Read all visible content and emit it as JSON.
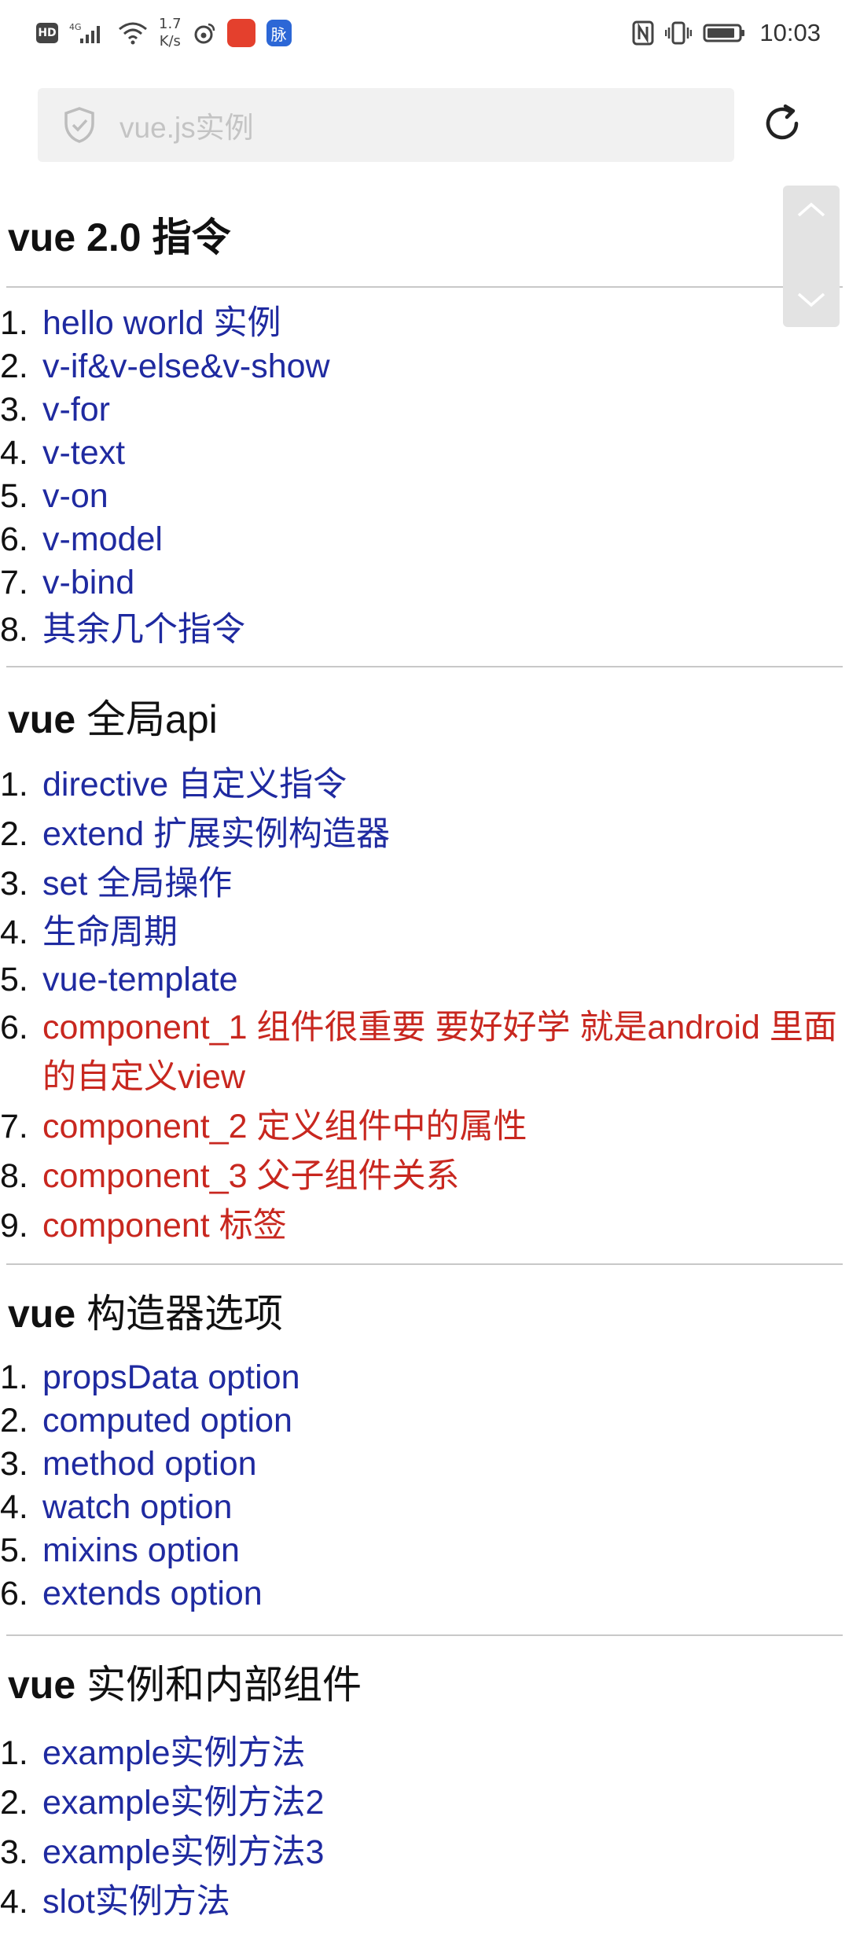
{
  "status_bar": {
    "hd": "HD",
    "network": "4G",
    "net_speed_value": "1.7",
    "net_speed_unit": "K/s",
    "time": "10:03",
    "app_badge_b": "脉",
    "icons": [
      "hd-icon",
      "signal-4g-icon",
      "wifi-icon",
      "net-speed",
      "weibo-icon",
      "app-badge-icon",
      "mai-app-icon",
      "nfc-icon",
      "vibrate-icon",
      "battery-icon"
    ]
  },
  "address_bar": {
    "url": "vue.js实例",
    "icons": [
      "shield-icon",
      "reload-icon"
    ]
  },
  "scroll_control": {
    "icons": [
      "chevron-up-icon",
      "chevron-down-icon"
    ]
  },
  "sections": [
    {
      "heading_bold": "vue 2.0 ",
      "heading_rest": "指令",
      "items": [
        {
          "num": "1.",
          "text": "hello world 实例",
          "color": "#1f2aa0"
        },
        {
          "num": "2.",
          "text": "v-if&v-else&v-show",
          "color": "#1f2aa0"
        },
        {
          "num": "3.",
          "text": "v-for",
          "color": "#1f2aa0"
        },
        {
          "num": "4.",
          "text": "v-text",
          "color": "#1f2aa0"
        },
        {
          "num": "5.",
          "text": "v-on",
          "color": "#1f2aa0"
        },
        {
          "num": "6.",
          "text": "v-model",
          "color": "#1f2aa0"
        },
        {
          "num": "7.",
          "text": "v-bind",
          "color": "#1f2aa0"
        },
        {
          "num": "8.",
          "text": "其余几个指令",
          "color": "#1f2aa0"
        }
      ]
    },
    {
      "heading_bold": "vue ",
      "heading_rest": "全局api",
      "items": [
        {
          "num": "1.",
          "text": "directive 自定义指令",
          "color": "#1f2aa0"
        },
        {
          "num": "2.",
          "text": "extend 扩展实例构造器",
          "color": "#1f2aa0"
        },
        {
          "num": "3.",
          "text": "set 全局操作",
          "color": "#1f2aa0"
        },
        {
          "num": "4.",
          "text": "生命周期",
          "color": "#1f2aa0"
        },
        {
          "num": "5.",
          "text": "vue-template",
          "color": "#1f2aa0"
        },
        {
          "num": "6.",
          "text": "component_1 组件很重要 要好好学 就是android 里面的自定义view",
          "color": "#c8271f"
        },
        {
          "num": "7.",
          "text": "component_2 定义组件中的属性",
          "color": "#c8271f"
        },
        {
          "num": "8.",
          "text": "component_3 父子组件关系",
          "color": "#c8271f"
        },
        {
          "num": "9.",
          "text": "component 标签",
          "color": "#c8271f"
        }
      ]
    },
    {
      "heading_bold": "vue ",
      "heading_rest": "构造器选项",
      "items": [
        {
          "num": "1.",
          "text": "propsData option",
          "color": "#1f2aa0"
        },
        {
          "num": "2.",
          "text": "computed option",
          "color": "#1f2aa0"
        },
        {
          "num": "3.",
          "text": "method option",
          "color": "#1f2aa0"
        },
        {
          "num": "4.",
          "text": "watch option",
          "color": "#1f2aa0"
        },
        {
          "num": "5.",
          "text": "mixins option",
          "color": "#1f2aa0"
        },
        {
          "num": "6.",
          "text": "extends option",
          "color": "#1f2aa0"
        }
      ]
    },
    {
      "heading_bold": "vue ",
      "heading_rest": "实例和内部组件",
      "items": [
        {
          "num": "1.",
          "text": "example实例方法",
          "color": "#1f2aa0"
        },
        {
          "num": "2.",
          "text": "example实例方法2",
          "color": "#1f2aa0"
        },
        {
          "num": "3.",
          "text": "example实例方法3",
          "color": "#1f2aa0"
        },
        {
          "num": "4.",
          "text": "slot实例方法",
          "color": "#1f2aa0"
        }
      ]
    }
  ]
}
